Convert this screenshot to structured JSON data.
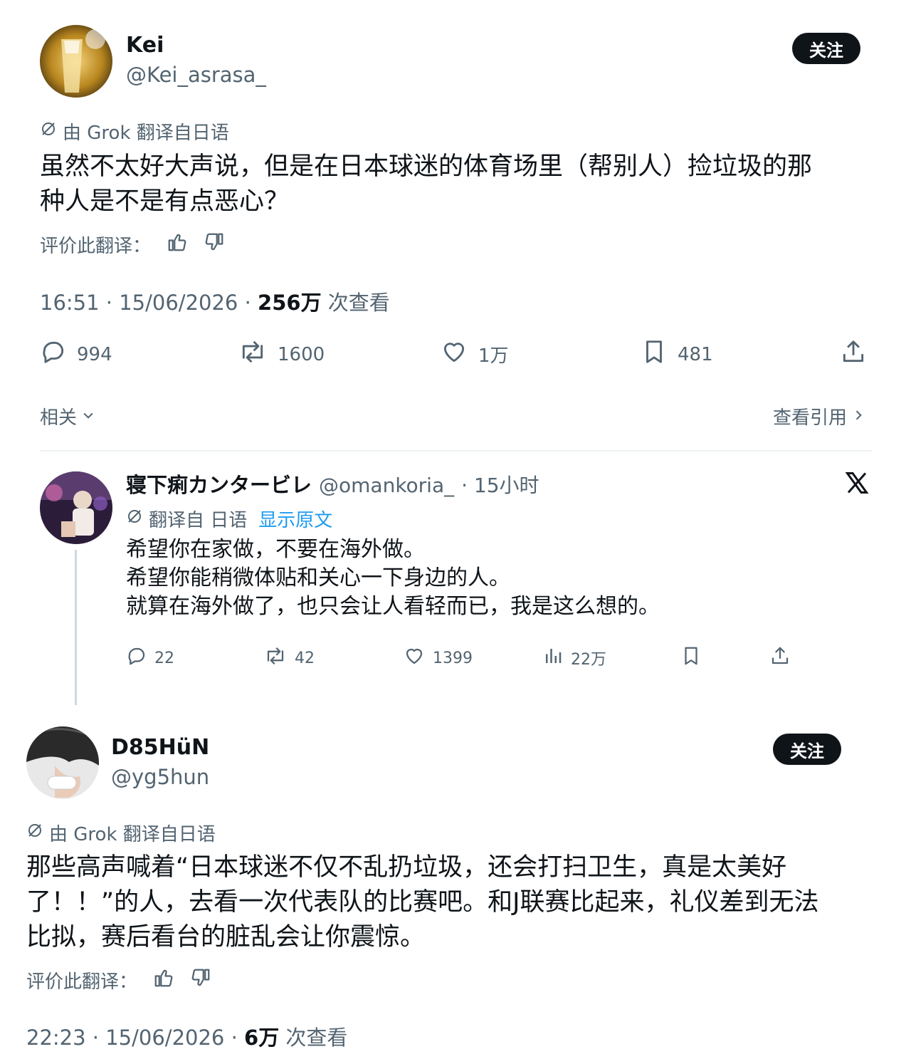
{
  "post1": {
    "name": "Kei",
    "handle": "@Kei_asrasa_",
    "follow_label": "关注",
    "translation_note": "由 Grok 翻译自日语",
    "text_line1": "虽然不太好大声说，但是在日本球迷的体育场里（帮别人）捡垃圾的那",
    "text_line2": "种人是不是有点恶心？",
    "rate_label": "评价此翻译：",
    "time": "16:51 · 15/06/2026 · ",
    "views_count": "256万",
    "views_label": " 次查看",
    "replies": "994",
    "reposts": "1600",
    "likes": "1万",
    "bookmarks": "481",
    "related_label": "相关",
    "quotes_label": "查看引用"
  },
  "reply": {
    "name": "寝下痢カンタービレ",
    "handle": "@omankoria_",
    "time": "· 15小时",
    "translation_note": "翻译自 日语",
    "show_original": "显示原文",
    "line1": "希望你在家做，不要在海外做。",
    "line2": "希望你能稍微体贴和关心一下身边的人。",
    "line3": "就算在海外做了，也只会让人看轻而已，我是这么想的。",
    "replies": "22",
    "reposts": "42",
    "likes": "1399",
    "views": "22万"
  },
  "post2": {
    "name": "D85HüN",
    "handle": "@yg5hun",
    "follow_label": "关注",
    "translation_note": "由 Grok 翻译自日语",
    "text_line1": "那些高声喊着“日本球迷不仅不乱扔垃圾，还会打扫卫生，真是太美好",
    "text_line2": "了！！”的人，去看一次代表队的比赛吧。和J联赛比起来，礼仪差到无法",
    "text_line3": "比拟，赛后看台的脏乱会让你震惊。",
    "rate_label": "评价此翻译：",
    "time": "22:23 · 15/06/2026 · ",
    "views_count": "6万",
    "views_label": " 次查看"
  },
  "colors": {
    "text": "#0f1419",
    "secondary": "#536471",
    "link": "#1d9bf0",
    "divider": "#eff3f4"
  }
}
